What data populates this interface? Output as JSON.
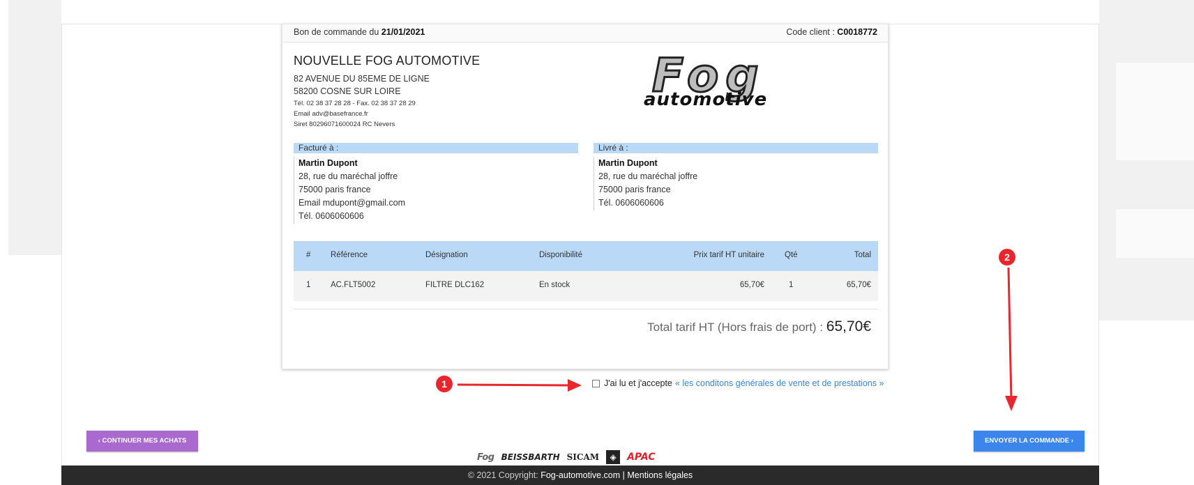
{
  "header": {
    "order_label": "Bon de commande du",
    "order_date": "21/01/2021",
    "client_label": "Code client :",
    "client_code": "C0018772"
  },
  "company": {
    "name": "NOUVELLE FOG AUTOMOTIVE",
    "address1": "82 AVENUE DU 85EME DE LIGNE",
    "address2": "58200 COSNE SUR LOIRE",
    "phone_fax": "Tél. 02 38 37 28 28 - Fax. 02 38 37 28 29",
    "email": "Email adv@basefrance.fr",
    "siret": "Siret 80296071600024 RC Nevers",
    "logo_top": "Fog",
    "logo_bottom": "automotive"
  },
  "billing": {
    "title": "Facturé à :",
    "name": "Martin Dupont",
    "street": "28, rue du maréchal joffre",
    "city": "75000 paris france",
    "email": "Email mdupont@gmail.com",
    "phone": "Tél. 0606060606"
  },
  "shipping": {
    "title": "Livré à :",
    "name": "Martin Dupont",
    "street": "28, rue du maréchal joffre",
    "city": "75000 paris france",
    "phone": "Tél. 0606060606"
  },
  "table": {
    "headers": [
      "#",
      "Référence",
      "Désignation",
      "Disponibilité",
      "Prix tarif HT unitaire",
      "Qté",
      "Total"
    ],
    "rows": [
      [
        "1",
        "AC.FLT5002",
        "FILTRE DLC162",
        "En stock",
        "65,70€",
        "1",
        "65,70€"
      ]
    ]
  },
  "total": {
    "label": "Total tarif HT (Hors frais de port) :",
    "amount": "65,70€"
  },
  "accept": {
    "text": "J'ai lu et j'accepte",
    "link": "« les conditons générales de vente et de prestations »"
  },
  "markers": [
    "1",
    "2"
  ],
  "buttons": {
    "continue": "‹  CONTINUER MES ACHATS",
    "send": "ENVOYER LA COMMANDE  ›"
  },
  "brands": [
    "Fog",
    "BEISSBARTH",
    "SICAM",
    "APAC"
  ],
  "footer": {
    "copyright": "© 2021 Copyright:",
    "site": "Fog-automotive.com",
    "separator": "|",
    "legal": "Mentions légales"
  },
  "colors": {
    "blue_header": "#b9d9f7",
    "accent_blue": "#3b86ec",
    "accent_purple": "#a969cf",
    "marker_red": "#e8262c",
    "footer_bg": "#2a2a2a"
  }
}
